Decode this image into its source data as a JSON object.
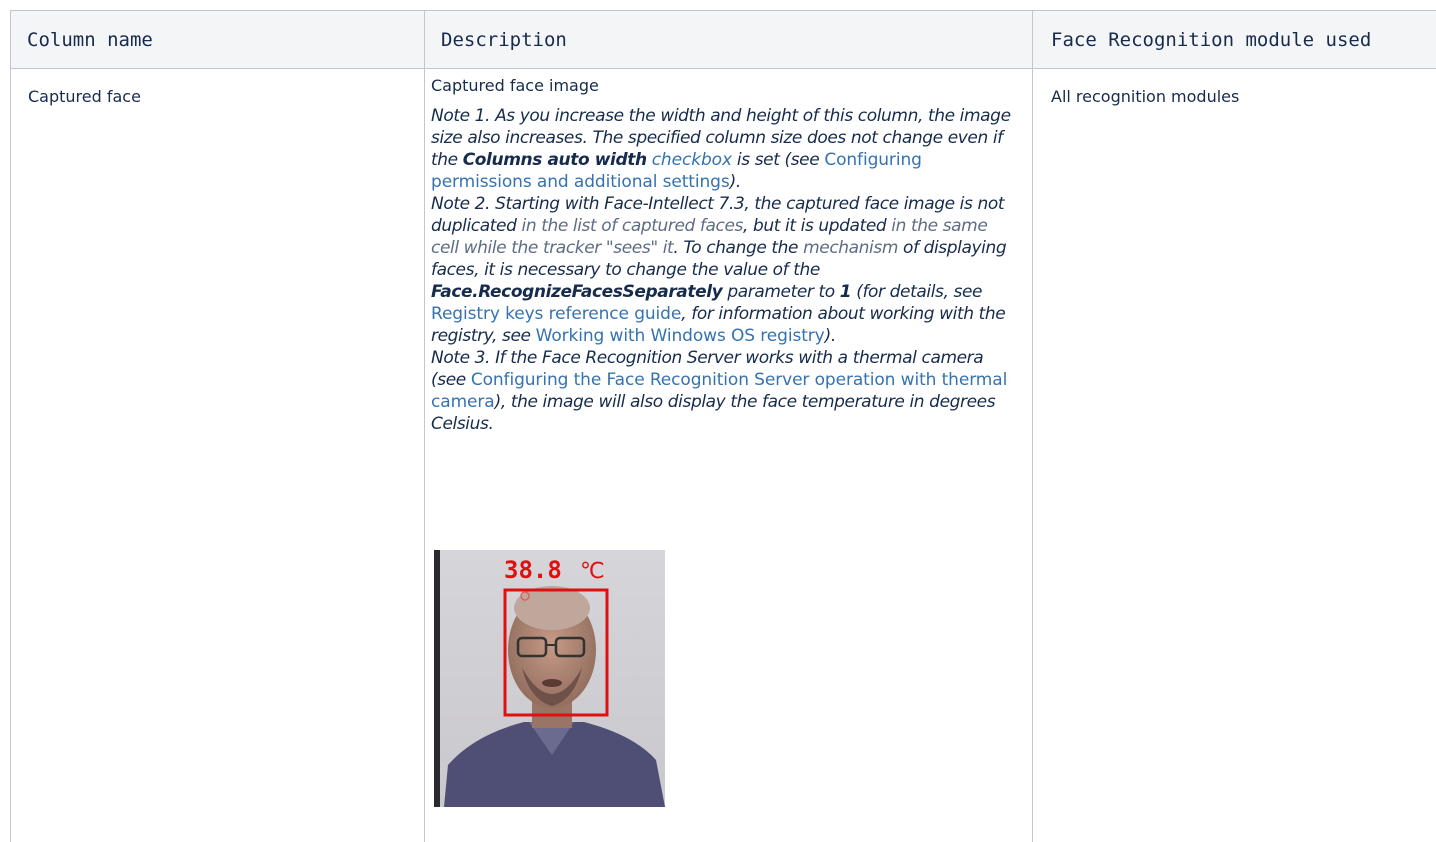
{
  "table": {
    "headers": [
      "Column name",
      "Description",
      "Face Recognition module used"
    ],
    "row": {
      "column_name": "Captured face",
      "module": "All recognition modules",
      "description": {
        "title": "Captured face image",
        "note1": {
          "p1": "Note 1. As you increase the width and height of this column, the image size also increases. The specified column size does not change even if the ",
          "bold": "Columns auto width",
          "link1": "checkbox",
          "p2": " is set (see ",
          "link2": "Configuring permissions and additional settings",
          "p3": ")."
        },
        "note2": {
          "p1": "Note 2. Starting with Face-Intellect 7.3, the captured face image is not duplicated ",
          "g1": "in the list of captured faces",
          "p2": ", but it is updated ",
          "g2": "in the same cell while the tracker \"sees\" it",
          "p3": ". To change the ",
          "g3": "mechanism",
          "p4": " of displaying faces, it is necessary to change the value of the ",
          "bold1": "Face.RecognizeFacesSeparately",
          "p5": " parameter to ",
          "bold2": "1",
          "p6": " (for details, see ",
          "link1": "Registry keys reference guide",
          "p7": ", for information about working with the registry, see ",
          "link2": "Working with Windows OS registry",
          "p8": ")."
        },
        "note3": {
          "p1": "Note 3. If the Face Recognition Server works with a thermal camera (see ",
          "link1": "Configuring the Face Recognition Server operation with thermal camera",
          "p2": "), the image will also display the face temperature in degrees Celsius."
        },
        "image": {
          "temperature": "38.8",
          "unit": "℃"
        }
      }
    }
  },
  "colors": {
    "link": "#3572b0",
    "border": "#c1c7d0",
    "header_bg": "#f4f5f7",
    "face_box": "#e01010"
  }
}
